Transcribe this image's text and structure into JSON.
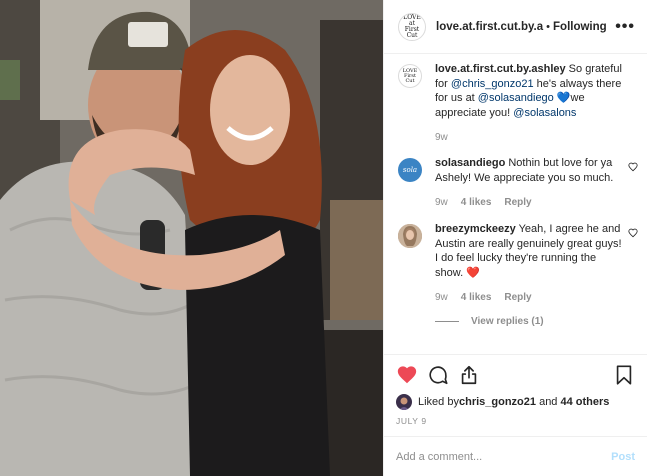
{
  "header": {
    "username": "love.at.first.cut.by.a",
    "follow_status": "Following",
    "separator": "•",
    "more": "•••",
    "logo_text": [
      "LOVE",
      "at",
      "First Cut"
    ]
  },
  "comments": [
    {
      "username": "love.at.first.cut.by.ashley",
      "parts": [
        {
          "t": " So grateful for ",
          "m": false
        },
        {
          "t": "@chris_gonzo21",
          "m": true
        },
        {
          "t": " he's always there for us at ",
          "m": false
        },
        {
          "t": "@solasandiego",
          "m": true
        },
        {
          "t": " 💙we appreciate you! ",
          "m": false
        },
        {
          "t": "@solasalons",
          "m": true
        }
      ],
      "time": "9w",
      "likes": "",
      "reply": ""
    },
    {
      "username": "solasandiego",
      "text": " Nothin but love for ya Ashely! We appreciate you so much.",
      "time": "9w",
      "likes": "4 likes",
      "reply": "Reply",
      "avatar_text": "sola"
    },
    {
      "username": "breezymckeezy",
      "text": " Yeah, I agree he and Austin are really genuinely great guys! I do feel lucky they're running the show. ❤️",
      "time": "9w",
      "likes": "4 likes",
      "reply": "Reply"
    }
  ],
  "view_replies": "View replies (1)",
  "likes_line": {
    "prefix": "Liked by ",
    "user": "chris_gonzo21",
    "middle": " and ",
    "count": "44 others"
  },
  "date": "JULY 9",
  "add_comment": {
    "placeholder": "Add a comment...",
    "post": "Post"
  },
  "colors": {
    "like_red": "#ed4956",
    "mention_blue": "#00376b",
    "post_disabled": "#b2dffc",
    "sola_blue": "#3b84c4"
  },
  "icons": [
    "heart-filled-icon",
    "comment-icon",
    "share-icon",
    "bookmark-icon",
    "heart-outline-icon",
    "more-icon"
  ]
}
